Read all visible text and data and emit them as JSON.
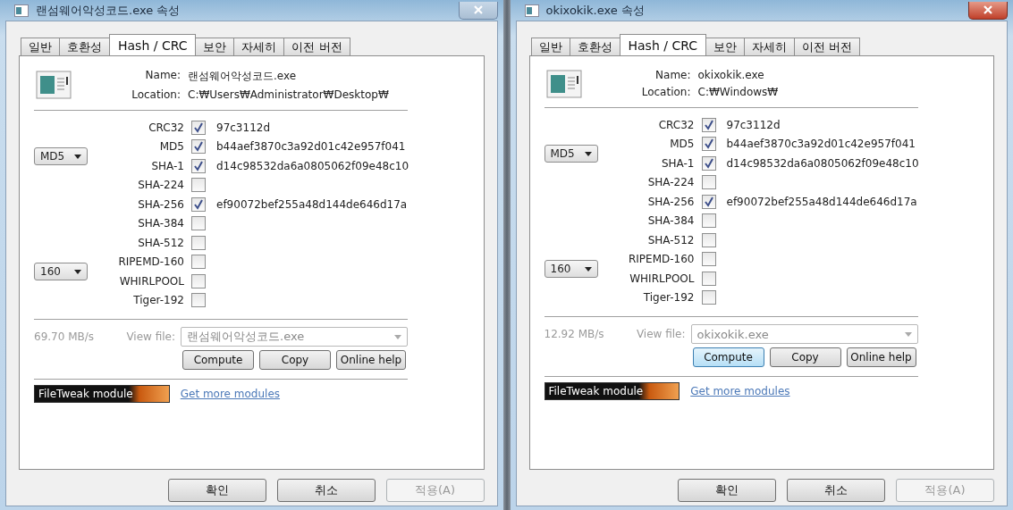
{
  "dialogs": [
    {
      "title": "랜섬웨어악성코드.exe 속성",
      "active": false,
      "tabs": [
        {
          "label": "일반",
          "selected": false
        },
        {
          "label": "호환성",
          "selected": false
        },
        {
          "label": "Hash / CRC",
          "selected": true
        },
        {
          "label": "보안",
          "selected": false
        },
        {
          "label": "자세히",
          "selected": false
        },
        {
          "label": "이전 버전",
          "selected": false
        }
      ],
      "name_label": "Name:",
      "name": "랜섬웨어악성코드.exe",
      "location_label": "Location:",
      "location": "C:₩Users₩Administrator₩Desktop₩",
      "selectors": [
        "MD5",
        "160"
      ],
      "algorithms": [
        {
          "name": "CRC32",
          "checked": true,
          "hash": "97c3112d"
        },
        {
          "name": "MD5",
          "checked": true,
          "hash": "b44aef3870c3a92d01c42e957f041"
        },
        {
          "name": "SHA-1",
          "checked": true,
          "hash": "d14c98532da6a0805062f09e48c10"
        },
        {
          "name": "SHA-224",
          "checked": false
        },
        {
          "name": "SHA-256",
          "checked": true,
          "hash": "ef90072bef255a48d144de646d17a"
        },
        {
          "name": "SHA-384",
          "checked": false
        },
        {
          "name": "SHA-512",
          "checked": false
        },
        {
          "name": "RIPEMD-160",
          "checked": false
        },
        {
          "name": "WHIRLPOOL",
          "checked": false
        },
        {
          "name": "Tiger-192",
          "checked": false
        }
      ],
      "speed": "69.70 MB/s",
      "view_file_label": "View file:",
      "view_file": "랜섬웨어악성코드.exe",
      "buttons": [
        {
          "label": "Compute",
          "focused": false
        },
        {
          "label": "Copy",
          "focused": false
        },
        {
          "label": "Online help",
          "focused": false
        }
      ],
      "module_badge": "FileTweak module",
      "more_link": "Get more modules",
      "dialog_buttons": [
        {
          "label": "확인",
          "disabled": false
        },
        {
          "label": "취소",
          "disabled": false
        },
        {
          "label": "적용(A)",
          "disabled": true
        }
      ]
    },
    {
      "title": "okixokik.exe 속성",
      "active": true,
      "tabs": [
        {
          "label": "일반",
          "selected": false
        },
        {
          "label": "호환성",
          "selected": false
        },
        {
          "label": "Hash / CRC",
          "selected": true
        },
        {
          "label": "보안",
          "selected": false
        },
        {
          "label": "자세히",
          "selected": false
        },
        {
          "label": "이전 버전",
          "selected": false
        }
      ],
      "name_label": "Name:",
      "name": "okixokik.exe",
      "location_label": "Location:",
      "location": "C:₩Windows₩",
      "selectors": [
        "MD5",
        "160"
      ],
      "algorithms": [
        {
          "name": "CRC32",
          "checked": true,
          "hash": "97c3112d"
        },
        {
          "name": "MD5",
          "checked": true,
          "hash": "b44aef3870c3a92d01c42e957f041"
        },
        {
          "name": "SHA-1",
          "checked": true,
          "hash": "d14c98532da6a0805062f09e48c10"
        },
        {
          "name": "SHA-224",
          "checked": false
        },
        {
          "name": "SHA-256",
          "checked": true,
          "hash": "ef90072bef255a48d144de646d17a"
        },
        {
          "name": "SHA-384",
          "checked": false
        },
        {
          "name": "SHA-512",
          "checked": false
        },
        {
          "name": "RIPEMD-160",
          "checked": false
        },
        {
          "name": "WHIRLPOOL",
          "checked": false
        },
        {
          "name": "Tiger-192",
          "checked": false
        }
      ],
      "speed": "12.92 MB/s",
      "view_file_label": "View file:",
      "view_file": "okixokik.exe",
      "buttons": [
        {
          "label": "Compute",
          "focused": true
        },
        {
          "label": "Copy",
          "focused": false
        },
        {
          "label": "Online help",
          "focused": false
        }
      ],
      "module_badge": "FileTweak module",
      "more_link": "Get more modules",
      "dialog_buttons": [
        {
          "label": "확인",
          "disabled": false
        },
        {
          "label": "취소",
          "disabled": false
        },
        {
          "label": "적용(A)",
          "disabled": true
        }
      ]
    }
  ]
}
